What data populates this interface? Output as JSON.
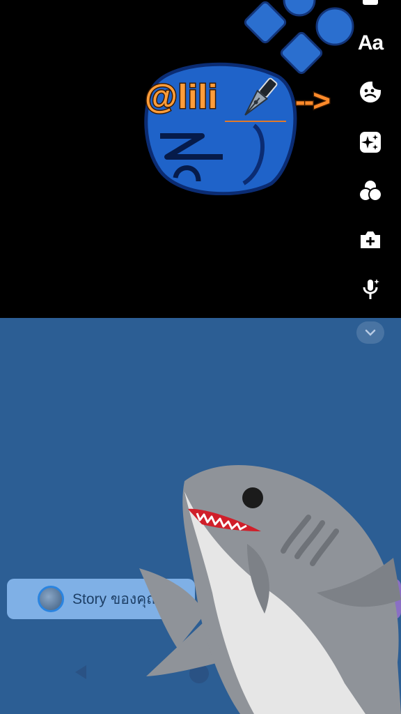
{
  "sticker": {
    "mention": "@lili",
    "arrow": "-->"
  },
  "tools": {
    "text_label": "Aa",
    "items": [
      "text-tool",
      "sticker-tool",
      "effects-tool",
      "filters-tool",
      "add-photo-tool",
      "voice-effect-tool"
    ]
  },
  "footer": {
    "story_label": "Story ของคุณ"
  },
  "colors": {
    "top_background": "#000000",
    "bottom_background": "#2c5e94",
    "mention_orange": "#ff9d3a",
    "story_button": "#7fb0e6",
    "purple_button": "#8a6fc4"
  }
}
